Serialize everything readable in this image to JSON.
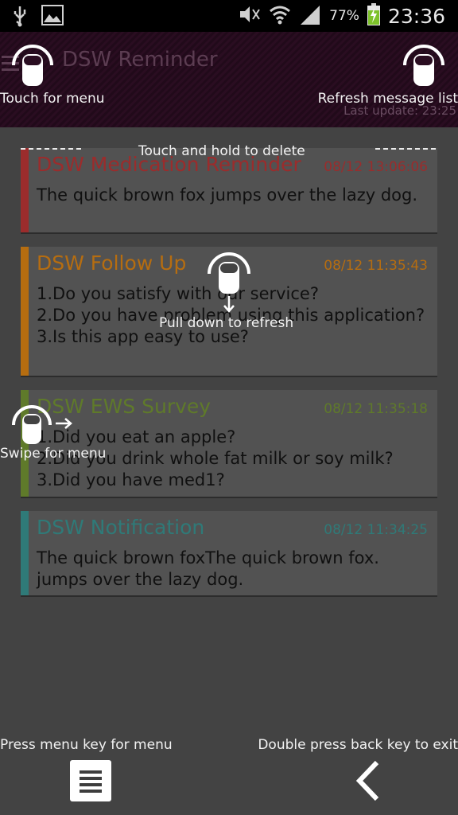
{
  "status_bar": {
    "battery_percent": "77%",
    "time": "23:36",
    "icons": [
      "usb-icon",
      "image-icon",
      "mute-icon",
      "wifi-icon",
      "signal-icon",
      "battery-charging-icon"
    ]
  },
  "header": {
    "title": "DSW Reminder",
    "last_update": "Last update: 23:25"
  },
  "messages": [
    {
      "title": "DSW Medication Reminder",
      "time": "08/12 13:06:06",
      "body": "The quick brown fox jumps over the lazy dog.",
      "color": "#9b2c2c"
    },
    {
      "title": "DSW Follow Up",
      "time": "08/12 11:35:43",
      "body": "1.Do you satisfy with our service?\n2.Do you have problem using this application?\n3.Is this app easy to use?",
      "color": "#b66d10"
    },
    {
      "title": "DSW EWS Survey",
      "time": "08/12 11:35:18",
      "body": "1.Did you eat an apple?\n2.Did you drink whole fat milk or soy milk?\n3.Did you have med1?",
      "color": "#5f7a2a"
    },
    {
      "title": "DSW Notification",
      "time": "08/12 11:34:25",
      "body": "The quick brown foxThe quick brown fox. jumps over the lazy dog.",
      "color": "#2f7a78"
    }
  ],
  "tips": {
    "touch_menu": "Touch for menu",
    "refresh": "Refresh message list",
    "hold_delete": "Touch and hold to delete",
    "pull_refresh": "Pull down to refresh",
    "swipe_menu": "Swipe for menu",
    "press_menu": "Press menu key for menu",
    "double_back": "Double press back key to exit"
  }
}
